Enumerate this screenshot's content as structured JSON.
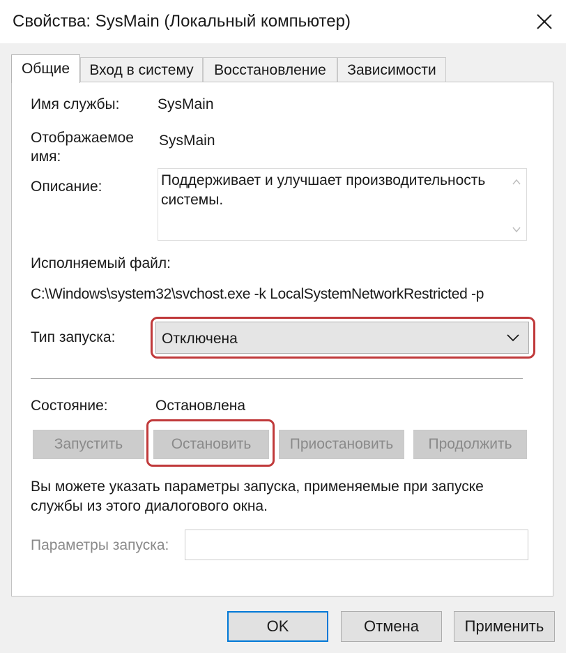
{
  "window": {
    "title": "Свойства: SysMain (Локальный компьютер)"
  },
  "tabs": [
    {
      "label": "Общие",
      "active": true
    },
    {
      "label": "Вход в систему",
      "active": false
    },
    {
      "label": "Восстановление",
      "active": false
    },
    {
      "label": "Зависимости",
      "active": false
    }
  ],
  "general": {
    "service_name_label": "Имя службы:",
    "service_name_value": "SysMain",
    "display_name_label_line1": "Отображаемое",
    "display_name_label_line2": "имя:",
    "display_name_value": "SysMain",
    "description_label": "Описание:",
    "description_value": "Поддерживает и улучшает производительность системы.",
    "executable_label": "Исполняемый файл:",
    "executable_path": "C:\\Windows\\system32\\svchost.exe -k LocalSystemNetworkRestricted -p",
    "startup_type_label": "Тип запуска:",
    "startup_type_value": "Отключена",
    "status_label": "Состояние:",
    "status_value": "Остановлена"
  },
  "service_buttons": {
    "start": "Запустить",
    "stop": "Остановить",
    "pause": "Приостановить",
    "resume": "Продолжить"
  },
  "info_text": "Вы можете указать параметры запуска, применяемые при запуске службы из этого диалогового окна.",
  "start_params": {
    "label": "Параметры запуска:",
    "value": ""
  },
  "dialog_buttons": {
    "ok": "OK",
    "cancel": "Отмена",
    "apply": "Применить"
  },
  "colors": {
    "highlight": "#c0393a",
    "default_button_border": "#0078d7"
  }
}
